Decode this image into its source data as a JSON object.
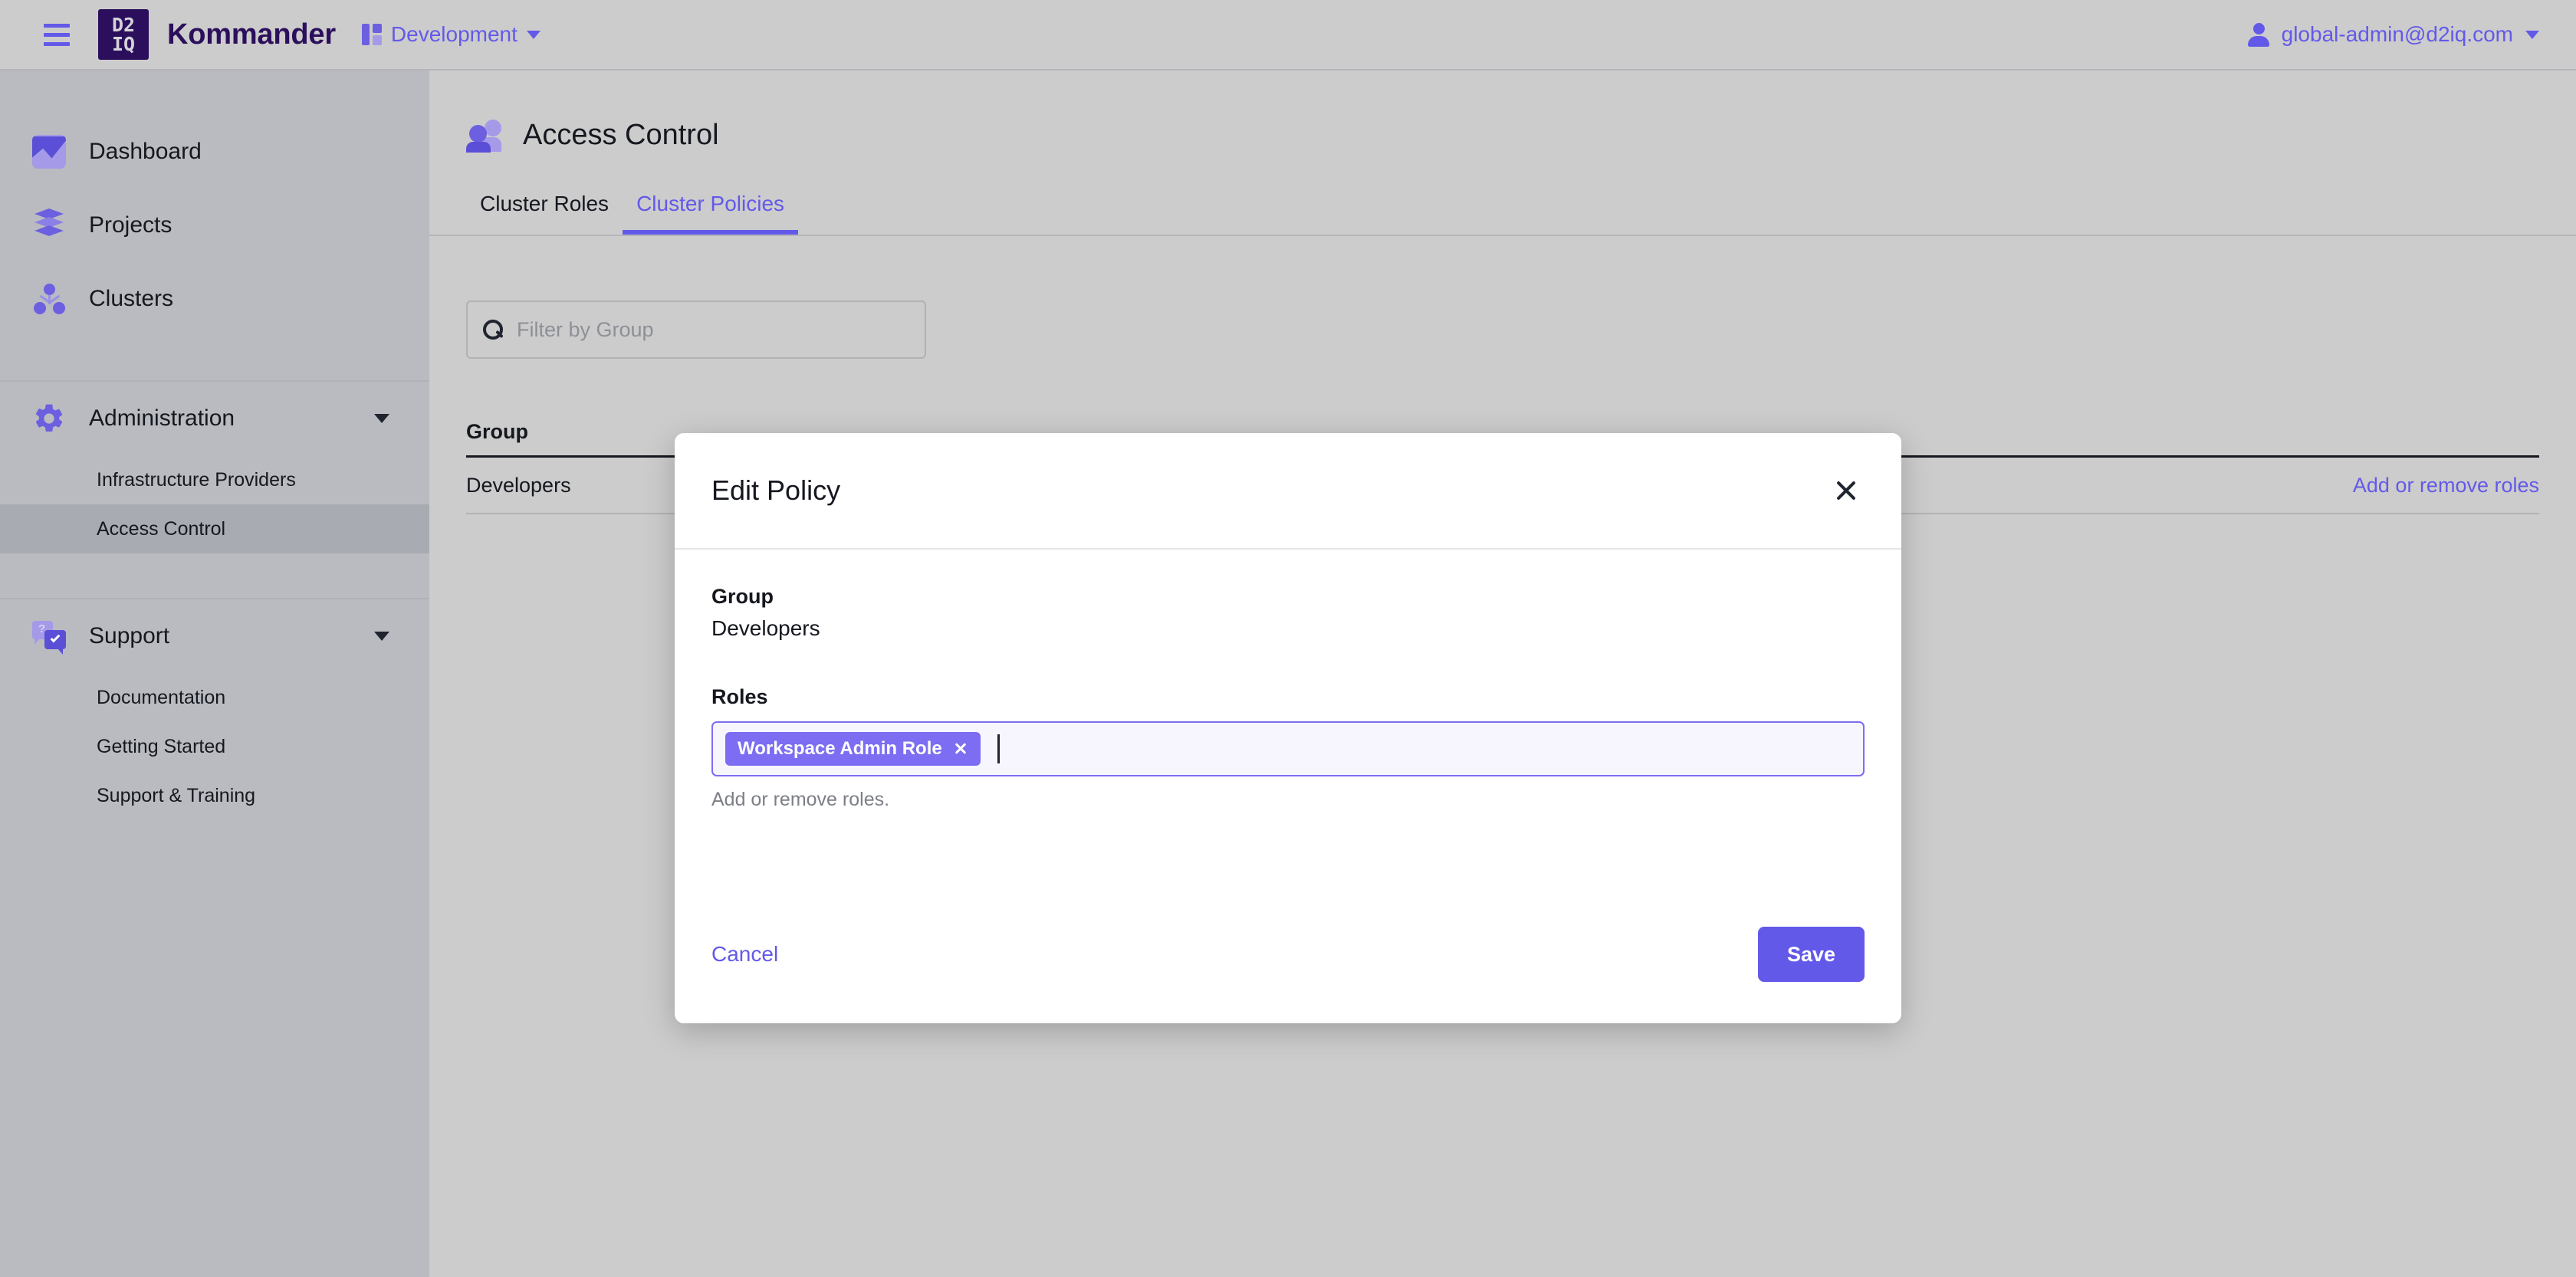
{
  "topbar": {
    "menu_icon": "hamburger-icon",
    "logo_line1": "D2",
    "logo_line2": "IQ",
    "brand": "Kommander",
    "workspace": {
      "label": "Development",
      "icon": "workspace-icon"
    },
    "user": {
      "label": "global-admin@d2iq.com",
      "icon": "person-icon"
    }
  },
  "sidebar": {
    "items": [
      {
        "label": "Dashboard",
        "icon": "dashboard-icon"
      },
      {
        "label": "Projects",
        "icon": "projects-icon"
      },
      {
        "label": "Clusters",
        "icon": "clusters-icon"
      }
    ],
    "administration": {
      "label": "Administration",
      "icon": "gear-icon",
      "expanded": true,
      "children": [
        {
          "label": "Infrastructure Providers",
          "active": false
        },
        {
          "label": "Access Control",
          "active": true
        }
      ]
    },
    "support": {
      "label": "Support",
      "icon": "support-icon",
      "expanded": true,
      "children": [
        {
          "label": "Documentation"
        },
        {
          "label": "Getting Started"
        },
        {
          "label": "Support & Training"
        }
      ]
    }
  },
  "page": {
    "title": "Access Control",
    "icon": "people-icon",
    "tabs": [
      {
        "label": "Cluster Roles",
        "active": false
      },
      {
        "label": "Cluster Policies",
        "active": true
      }
    ],
    "filter": {
      "placeholder": "Filter by Group",
      "value": "",
      "icon": "search-icon"
    },
    "table": {
      "columns": [
        "Group"
      ],
      "rows": [
        {
          "group": "Developers",
          "action": "Add or remove roles"
        }
      ]
    }
  },
  "modal": {
    "title": "Edit Policy",
    "close_icon": "close-icon",
    "group_label": "Group",
    "group_value": "Developers",
    "roles_label": "Roles",
    "role_chips": [
      "Workspace Admin Role"
    ],
    "roles_help": "Add or remove roles.",
    "cancel_label": "Cancel",
    "save_label": "Save"
  },
  "colors": {
    "accent": "#6359e9",
    "chip": "#7c6df2",
    "logo_bg": "#2c0f5c",
    "sidebar_bg": "#b9bbc0",
    "page_bg": "#cccccc"
  }
}
